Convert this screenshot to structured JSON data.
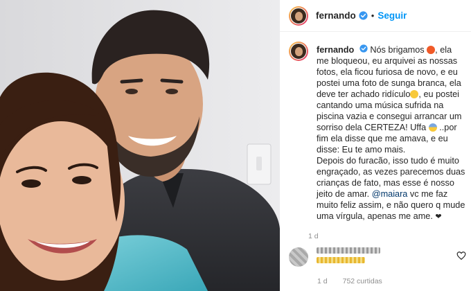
{
  "post": {
    "username": "fernando",
    "separator": "•",
    "follow_label": "Seguir",
    "caption": {
      "username": "fernando",
      "part1": " Nós brigamos ",
      "part2": ", ela me bloqueou, eu arquivei as nossas fotos, ela ficou furiosa de novo, e eu postei uma foto de sunga branca, ela deve ter achado ridículo",
      "part3": ", eu postei cantando uma música sufrida na piscina vazia e consegui arrancar um sorriso dela CERTEZA! Uffa ",
      "part4": " ..por fim ela disse que me amava, e eu disse: Eu te amo mais.",
      "part5": "Depois do furacão, isso tudo é muito engraçado, as vezes parecemos duas crianças de fato, mas esse é nosso jeito de amar. ",
      "mention": "@maiara",
      "part6": " vc me faz muito feliz assim, e não quero q mude uma vírgula, apenas me ame. ",
      "heart": "❤"
    },
    "time_ago": "1 d",
    "footer_time": "1 d",
    "footer_likes": "752 curtidas"
  },
  "icons": {
    "verified": "verified-badge-icon",
    "heart": "heart-icon",
    "emoji_angry": "angry-face-emoji",
    "emoji_sweat": "sweat-smile-emoji",
    "emoji_fear": "fearful-face-emoji"
  },
  "colors": {
    "link_blue": "#0095f6",
    "mention_blue": "#00376b",
    "muted": "#8e8e8e",
    "verified_blue": "#3897f0"
  }
}
